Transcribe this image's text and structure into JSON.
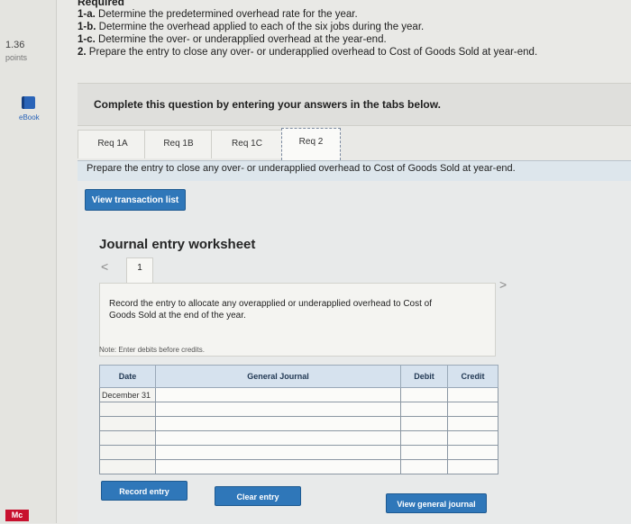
{
  "sidebar": {
    "points_value": "1.36",
    "points_label": "points",
    "ebook_label": "eBook",
    "logo_text": "Mc"
  },
  "requirements": {
    "title": "Required",
    "items": [
      {
        "label": "1-a.",
        "text": "Determine the predetermined overhead rate for the year."
      },
      {
        "label": "1-b.",
        "text": "Determine the overhead applied to each of the six jobs during the year."
      },
      {
        "label": "1-c.",
        "text": "Determine the over- or underapplied overhead at the year-end."
      },
      {
        "label": "2.",
        "text": "Prepare the entry to close any over- or underapplied overhead to Cost of Goods Sold at year-end."
      }
    ]
  },
  "instruction": "Complete this question by entering your answers in the tabs below.",
  "tabs": [
    {
      "label": "Req 1A",
      "active": false
    },
    {
      "label": "Req 1B",
      "active": false
    },
    {
      "label": "Req 1C",
      "active": false
    },
    {
      "label": "Req 2",
      "active": true
    }
  ],
  "panel": {
    "description": "Prepare the entry to close any over- or underapplied overhead to Cost of Goods Sold at year-end.",
    "view_transaction_label": "View transaction list",
    "worksheet_title": "Journal entry worksheet",
    "pager": {
      "prev": "<",
      "page": "1",
      "next": ">"
    },
    "record_instruction": "Record the entry to allocate any overapplied or underapplied overhead to Cost of Goods Sold at the end of the year.",
    "note": "Note: Enter debits before credits."
  },
  "journal": {
    "headers": {
      "date": "Date",
      "account": "General Journal",
      "debit": "Debit",
      "credit": "Credit"
    },
    "rows": [
      {
        "date": "December 31",
        "account": "",
        "debit": "",
        "credit": ""
      },
      {
        "date": "",
        "account": "",
        "debit": "",
        "credit": ""
      },
      {
        "date": "",
        "account": "",
        "debit": "",
        "credit": ""
      },
      {
        "date": "",
        "account": "",
        "debit": "",
        "credit": ""
      },
      {
        "date": "",
        "account": "",
        "debit": "",
        "credit": ""
      },
      {
        "date": "",
        "account": "",
        "debit": "",
        "credit": ""
      }
    ]
  },
  "actions": {
    "record_entry": "Record entry",
    "clear_entry": "Clear entry",
    "view_general_journal": "View general journal"
  }
}
